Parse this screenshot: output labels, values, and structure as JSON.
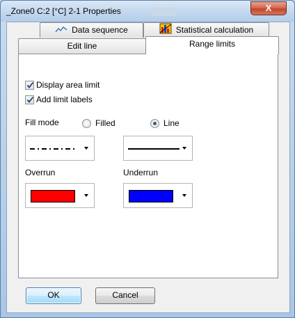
{
  "window": {
    "title": "_Zone0 C:2 [°C] 2-1 Properties",
    "close_label": "X"
  },
  "tabs": {
    "row1": [
      {
        "label": "Data sequence",
        "icon": "line-chart-icon"
      },
      {
        "label": "Statistical calculation",
        "icon": "statistics-icon"
      }
    ],
    "row2": [
      {
        "label": "Edit line"
      },
      {
        "label": "Range limits",
        "active": true
      }
    ]
  },
  "options": {
    "display_area_limit": {
      "label": "Display area limit",
      "checked": true
    },
    "add_limit_labels": {
      "label": "Add limit labels",
      "checked": true
    }
  },
  "fill_mode": {
    "label": "Fill mode",
    "options": [
      "Filled",
      "Line"
    ],
    "selected": "Line"
  },
  "line_styles": {
    "left": "dash-dot",
    "right": "solid"
  },
  "overrun": {
    "label": "Overrun",
    "color": "#ff0000"
  },
  "underrun": {
    "label": "Underrun",
    "color": "#0000ff"
  },
  "buttons": {
    "ok": "OK",
    "cancel": "Cancel"
  }
}
